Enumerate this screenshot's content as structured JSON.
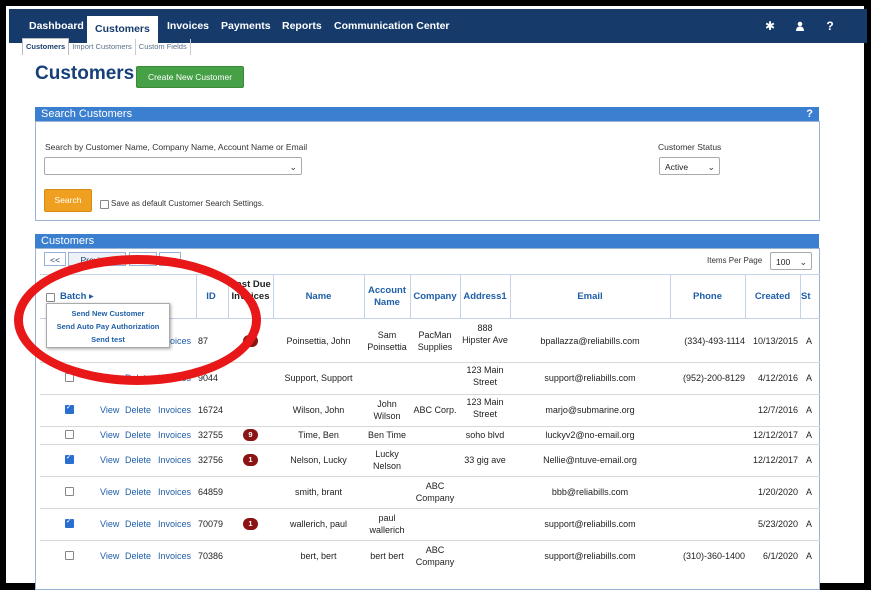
{
  "nav": {
    "items": [
      "Dashboard",
      "Customers",
      "Invoices",
      "Payments",
      "Reports",
      "Communication Center"
    ],
    "icons": [
      "gear-icon",
      "user-icon",
      "help-icon"
    ]
  },
  "subnav": [
    "Customers",
    "Import Customers",
    "Custom Fields"
  ],
  "page": {
    "title": "Customers",
    "create_button": "Create New Customer"
  },
  "search": {
    "panel_title": "Search Customers",
    "help": "?",
    "label": "Search by Customer Name, Company Name, Account Name or Email",
    "value": "",
    "status_label": "Customer Status",
    "status_value": "Active",
    "search_button": "Search",
    "save_default_label": "Save as default Customer Search Settings."
  },
  "customers": {
    "panel_title": "Customers",
    "pager": {
      "first": "<<",
      "prev": "Previous",
      "next": "Next",
      "last": ">>"
    },
    "items_per_page_label": "Items Per Page",
    "items_per_page": "100",
    "batch_label": "Batch",
    "batch_menu": [
      "Send New Customer",
      "Send Auto Pay Authorization",
      "Send test"
    ],
    "columns": [
      "ID",
      "Past Due Invoices",
      "Name",
      "Account Name",
      "Company",
      "Address1",
      "Email",
      "Phone",
      "Created",
      "St"
    ],
    "actions": [
      "View",
      "Delete",
      "Invoices"
    ],
    "rows": [
      {
        "checked": false,
        "id": "87",
        "past_due": "2",
        "name": "Poinsettia, John",
        "account": "Sam Poinsettia",
        "company": "PacMan Supplies",
        "address": "888 Hipster Ave",
        "email": "bpallazza@reliabills.com",
        "phone": "(334)-493-1114",
        "created": "10/13/2015",
        "st": "A"
      },
      {
        "checked": false,
        "id": "9044",
        "past_due": "",
        "name": "Support, Support",
        "account": "",
        "company": "",
        "address": "123 Main Street",
        "email": "support@reliabills.com",
        "phone": "(952)-200-8129",
        "created": "4/12/2016",
        "st": "A"
      },
      {
        "checked": true,
        "id": "16724",
        "past_due": "",
        "name": "Wilson, John",
        "account": "John Wilson",
        "company": "ABC Corp.",
        "address": "123 Main Street",
        "email": "marjo@submarine.org",
        "phone": "",
        "created": "12/7/2016",
        "st": "A"
      },
      {
        "checked": false,
        "id": "32755",
        "past_due": "9",
        "name": "Time, Ben",
        "account": "Ben Time",
        "company": "",
        "address": "soho blvd",
        "email": "luckyv2@no-email.org",
        "phone": "",
        "created": "12/12/2017",
        "st": "A"
      },
      {
        "checked": true,
        "id": "32756",
        "past_due": "1",
        "name": "Nelson, Lucky",
        "account": "Lucky Nelson",
        "company": "",
        "address": "33 gig ave",
        "email": "Nellie@ntuve-email.org",
        "phone": "",
        "created": "12/12/2017",
        "st": "A"
      },
      {
        "checked": false,
        "id": "64859",
        "past_due": "",
        "name": "smith, brant",
        "account": "",
        "company": "ABC Company",
        "address": "",
        "email": "bbb@reliabills.com",
        "phone": "",
        "created": "1/20/2020",
        "st": "A"
      },
      {
        "checked": true,
        "id": "70079",
        "past_due": "1",
        "name": "wallerich, paul",
        "account": "paul wallerich",
        "company": "",
        "address": "",
        "email": "support@reliabills.com",
        "phone": "",
        "created": "5/23/2020",
        "st": "A"
      },
      {
        "checked": false,
        "id": "70386",
        "past_due": "",
        "name": "bert, bert",
        "account": "bert bert",
        "company": "ABC Company",
        "address": "",
        "email": "support@reliabills.com",
        "phone": "(310)-360-1400",
        "created": "6/1/2020",
        "st": "A"
      }
    ]
  },
  "colors": {
    "nav_bg": "#163b6b",
    "panel_header": "#3b7fd0",
    "accent_green": "#46a046",
    "accent_orange": "#f0a020",
    "badge": "#8b1414",
    "annotation": "#e81818"
  }
}
